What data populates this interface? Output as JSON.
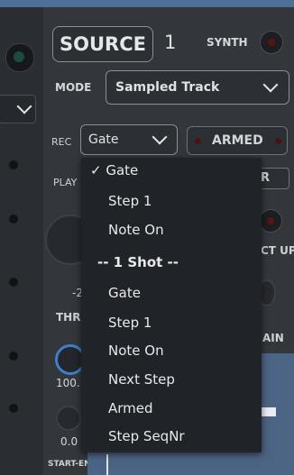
{
  "source": {
    "label": "SOURCE",
    "number": "1"
  },
  "synth": {
    "label": "SYNTH"
  },
  "mode": {
    "label": "MODE",
    "value": "Sampled Track"
  },
  "rec": {
    "label": "REC",
    "value": "Gate"
  },
  "armed": {
    "label": "ARMED"
  },
  "play": {
    "label": "PLAY"
  },
  "peeks": {
    "clear": "EAR",
    "count_up": "CT UP",
    "knob_value": "-2",
    "three": "THRE",
    "gain": "AIN",
    "value_100": "100.",
    "value_zero": "0.0"
  },
  "start_end": {
    "label": "START-END"
  },
  "dropdown": {
    "items": [
      {
        "text": "✓ Gate"
      },
      {
        "text": "Step 1"
      },
      {
        "text": "Note On"
      },
      {
        "text": "-- 1 Shot --"
      },
      {
        "text": "Gate"
      },
      {
        "text": "Step 1"
      },
      {
        "text": "Note On"
      },
      {
        "text": "Next Step"
      },
      {
        "text": "Armed"
      },
      {
        "text": "Step SeqNr"
      }
    ]
  },
  "colors": {
    "accent": "#3f7fc8",
    "header": "#4b6f97",
    "waveform": "#4c6483"
  }
}
